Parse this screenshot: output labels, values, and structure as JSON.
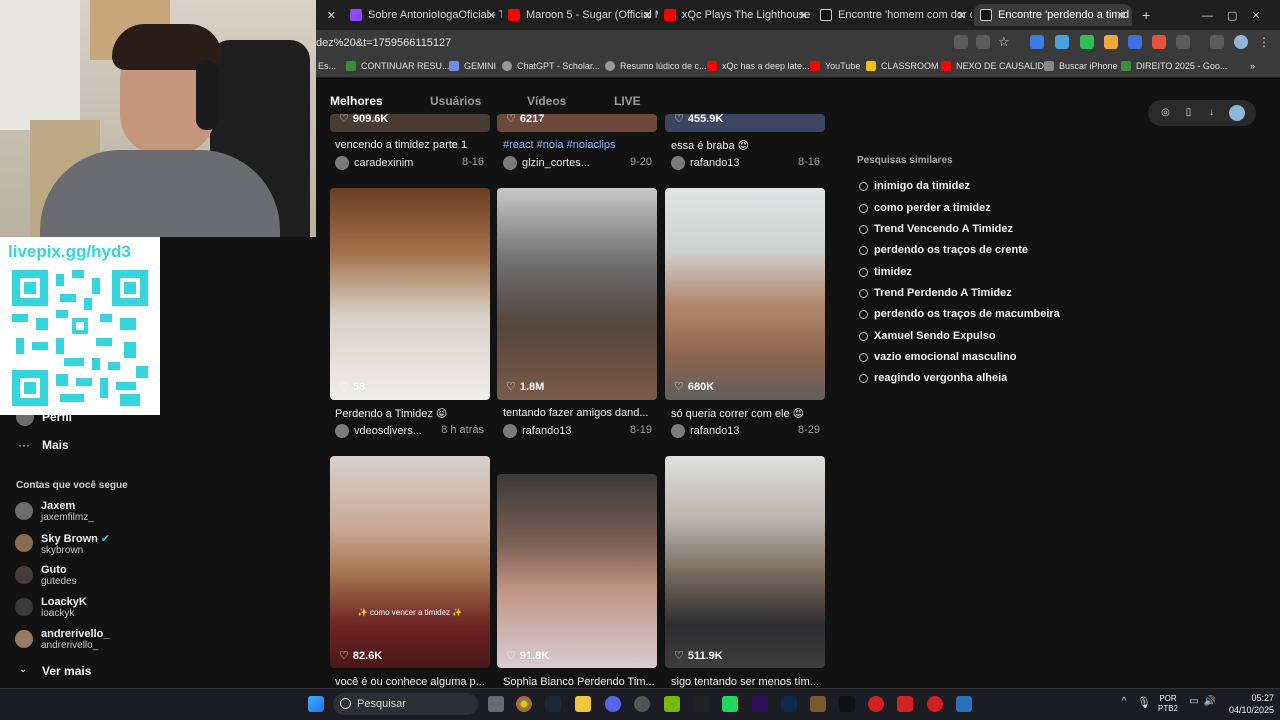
{
  "browser": {
    "tabs": [
      {
        "label": "Sobre AntonioIogaOficial - Tw"
      },
      {
        "label": "Maroon 5 - Sugar (Official Mu"
      },
      {
        "label": "xQc Plays The Lighthouse - You"
      },
      {
        "label": "Encontre 'homem com dor de ("
      },
      {
        "label": "Encontre 'perdendo a timid"
      }
    ],
    "new_tab": "+",
    "url": "dez%20&t=1759566115127",
    "bookmarks": [
      {
        "label": "Es..."
      },
      {
        "label": "CONTINUAR RESU..."
      },
      {
        "label": "GEMINI"
      },
      {
        "label": "ChatGPT - Scholar..."
      },
      {
        "label": "Resumo lúdico de c..."
      },
      {
        "label": "xQc has a deep late..."
      },
      {
        "label": "YouTube"
      },
      {
        "label": "CLASSROOM"
      },
      {
        "label": "NEXO DE CAUSALID..."
      },
      {
        "label": "Buscar iPhone"
      },
      {
        "label": "DIREITO 2025 - Goo..."
      }
    ]
  },
  "search_tabs": [
    "Melhores",
    "Usuários",
    "Vídeos",
    "LIVE"
  ],
  "videos": [
    {
      "likes": "909.6K",
      "title": "vencendo a timidez parte 1",
      "author": "caradexinim",
      "date": "8-16",
      "title_is_tag": false
    },
    {
      "likes": "6217",
      "title": "#react #noia #noiaclips",
      "author": "glzin_cortes...",
      "date": "9-20",
      "title_is_tag": true
    },
    {
      "likes": "455.9K",
      "title": "essa é braba 😡",
      "author": "rafando13",
      "date": "8-16",
      "title_is_tag": false
    },
    {
      "likes": "58",
      "title": "Perdendo a Timidez 😝",
      "author": "vdeosdivers...",
      "date": "8 h atrás",
      "title_is_tag": false
    },
    {
      "likes": "1.8M",
      "title": "tentando fazer amigos dand...",
      "author": "rafando13",
      "date": "8-19",
      "title_is_tag": false
    },
    {
      "likes": "680K",
      "title": "só queria correr com ele 😡",
      "author": "rafando13",
      "date": "8-29",
      "title_is_tag": false
    },
    {
      "likes": "82.6K",
      "title": "você é ou conhece alguma p...",
      "author": "",
      "date": "",
      "overlay": "✨ como vencer a timidez ✨",
      "title_is_tag": false
    },
    {
      "likes": "91.8K",
      "title": "Sophia Bianco Perdendo Tim...",
      "author": "",
      "date": "",
      "title_is_tag": false
    },
    {
      "likes": "511.9K",
      "title": "sigo tentando ser menos tím...",
      "author": "",
      "date": "",
      "title_is_tag": false
    }
  ],
  "similar": {
    "title": "Pesquisas similares",
    "items": [
      "inimigo da timidez",
      "como perder a timidez",
      "Trend Vencendo A Timidez",
      "perdendo os traços de crente",
      "timidez",
      "Trend Perdendo A Timidez",
      "perdendo os traços de macumbeira",
      "Xamuel Sendo Expulso",
      "vazio emocional masculino",
      "reagindo vergonha alheia"
    ]
  },
  "livepix": {
    "text": "livepix.gg/hyd3"
  },
  "sidebar": {
    "profile": "Perfil",
    "more": "Mais",
    "following_title": "Contas que você segue",
    "accounts": [
      {
        "name": "Jaxem",
        "handle": "jaxemfilmz_",
        "verified": false
      },
      {
        "name": "Sky Brown",
        "handle": "skybrown",
        "verified": true
      },
      {
        "name": "Guto",
        "handle": "gutedes",
        "verified": false
      },
      {
        "name": "LoackyK",
        "handle": "loackyk",
        "verified": false
      },
      {
        "name": "andrerivello_",
        "handle": "andrerivello_",
        "verified": false
      }
    ],
    "see_more": "Ver mais"
  },
  "taskbar": {
    "search_placeholder": "Pesquisar",
    "lang_top": "POR",
    "lang_bottom": "PTB2",
    "time": "05:27",
    "date": "04/10/2025"
  },
  "colors": {
    "accent_tag": "#8ab6ff",
    "livepix": "#34d5dc",
    "page_bg": "#121212"
  }
}
